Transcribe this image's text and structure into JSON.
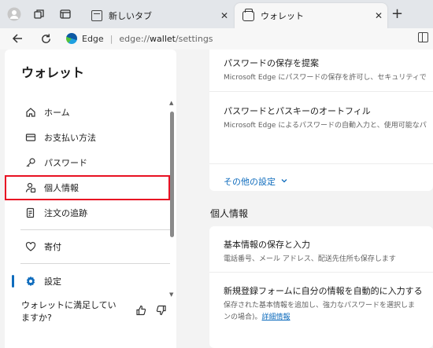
{
  "browser": {
    "tabs": [
      {
        "title": "新しいタブ",
        "active": false
      },
      {
        "title": "ウォレット",
        "active": true
      }
    ],
    "close_symbol": "✕",
    "new_tab_symbol": "+",
    "address": {
      "brand": "Edge",
      "separator": "|",
      "url_prefix": "edge://",
      "url_bold": "wallet",
      "url_suffix": "/settings"
    }
  },
  "sidebar": {
    "title": "ウォレット",
    "items": [
      {
        "label": "ホーム",
        "icon": "home-icon"
      },
      {
        "label": "お支払い方法",
        "icon": "card-icon"
      },
      {
        "label": "パスワード",
        "icon": "key-icon"
      },
      {
        "label": "個人情報",
        "icon": "person-icon",
        "highlighted": true
      },
      {
        "label": "注文の追跡",
        "icon": "receipt-icon"
      },
      {
        "label": "寄付",
        "icon": "heart-icon"
      },
      {
        "label": "設定",
        "icon": "gear-icon",
        "active": true
      }
    ],
    "feedback": {
      "line1": "ウォレットに満足してい",
      "line2": "ますか?"
    }
  },
  "content": {
    "rows_top": [
      {
        "title": "パスワードの保存を提案",
        "sub": "Microsoft Edge にパスワードの保存を許可し、セキュリティで"
      },
      {
        "title": "パスワードとパスキーのオートフィル",
        "sub": "Microsoft Edge によるパスワードの自動入力と、使用可能なパ"
      }
    ],
    "more_settings": "その他の設定",
    "section_title": "個人情報",
    "rows_bottom": [
      {
        "title": "基本情報の保存と入力",
        "sub": "電話番号、メール アドレス、配送先住所も保存します"
      },
      {
        "title": "新規登録フォームに自分の情報を自動的に入力する",
        "sub": "保存された基本情報を追加し、強力なパスワードを選択しま"
      }
    ],
    "last_sub_line2": "ンの場合)。",
    "detail_link": "詳細情報"
  },
  "colors": {
    "accent": "#0f6cbd",
    "highlight_border": "#e81123"
  }
}
